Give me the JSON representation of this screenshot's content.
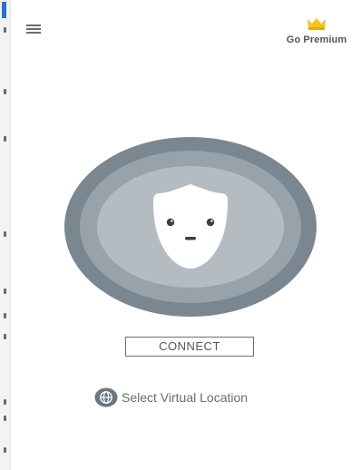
{
  "header": {
    "menu_icon": "hamburger-menu-icon",
    "premium_icon": "crown-icon",
    "premium_label": "Go Premium",
    "crown_color": "#f5c518"
  },
  "main": {
    "connect_label": "CONNECT",
    "location_label": "Select Virtual Location",
    "location_icon": "globe-icon",
    "ring_colors": [
      "#7b8790",
      "#98a2aa",
      "#b5bcc1"
    ],
    "mascot_icon": "shield-face-icon"
  }
}
